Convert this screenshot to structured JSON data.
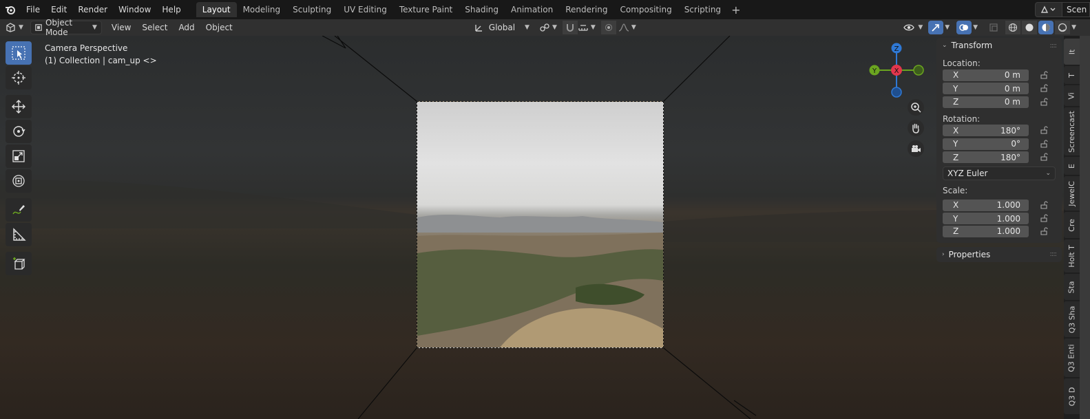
{
  "topbar": {
    "menus": [
      "File",
      "Edit",
      "Render",
      "Window",
      "Help"
    ],
    "workspaces": [
      "Layout",
      "Modeling",
      "Sculpting",
      "UV Editing",
      "Texture Paint",
      "Shading",
      "Animation",
      "Rendering",
      "Compositing",
      "Scripting"
    ],
    "active_workspace": "Layout",
    "add_tab": "+",
    "scene": "Scen"
  },
  "header": {
    "mode": "Object Mode",
    "menus": [
      "View",
      "Select",
      "Add",
      "Object"
    ],
    "orientation": "Global"
  },
  "viewport": {
    "title": "Camera Perspective",
    "subtitle": "(1) Collection | cam_up <>"
  },
  "gizmo": {
    "x": "X",
    "y": "Y",
    "z": "Z"
  },
  "npanel": {
    "transform_title": "Transform",
    "location_label": "Location:",
    "location": [
      {
        "axis": "X",
        "value": "0 m"
      },
      {
        "axis": "Y",
        "value": "0 m"
      },
      {
        "axis": "Z",
        "value": "0 m"
      }
    ],
    "rotation_label": "Rotation:",
    "rotation": [
      {
        "axis": "X",
        "value": "180°"
      },
      {
        "axis": "Y",
        "value": "0°"
      },
      {
        "axis": "Z",
        "value": "180°"
      }
    ],
    "rotation_mode": "XYZ Euler",
    "scale_label": "Scale:",
    "scale": [
      {
        "axis": "X",
        "value": "1.000"
      },
      {
        "axis": "Y",
        "value": "1.000"
      },
      {
        "axis": "Z",
        "value": "1.000"
      }
    ],
    "properties_title": "Properties"
  },
  "sidetabs": [
    "It",
    "T",
    "Vi",
    "Screencast",
    "E",
    "JewelC",
    "Cre",
    "Holt T",
    "Sta",
    "Q3 Sha",
    "Q3 Enti",
    "Q3 D"
  ],
  "colors": {
    "accent": "#4772b3",
    "x_axis": "#e2364c",
    "y_axis": "#6ba520",
    "z_axis": "#2f79d6"
  }
}
